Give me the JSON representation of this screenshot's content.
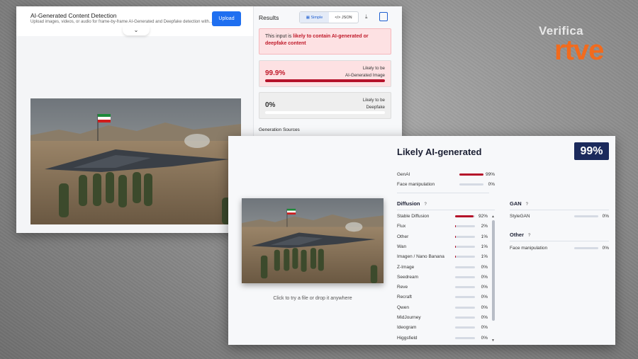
{
  "brand": {
    "top": "Verifica",
    "bottom": "rtve"
  },
  "back": {
    "title": "AI-Generated Content Detection",
    "subtitle": "Upload images, videos, or audio for frame-by-frame AI-Generated and Deepfake detection with...",
    "upload_label": "Upload",
    "results_title": "Results",
    "toggle_simple": "Simple",
    "toggle_json": "</> JSON",
    "alert_prefix": "This input is ",
    "alert_bold": "likely to contain AI-generated or deepfake content",
    "cards": [
      {
        "pct": "99.9%",
        "line1": "Likely to be",
        "line2": "AI-Generated Image",
        "value": 0.999,
        "color": "#c01a2a",
        "bg": "#fde1e3"
      },
      {
        "pct": "0%",
        "line1": "Likely to be",
        "line2": "Deepfake",
        "value": 0,
        "color": "#333333",
        "bg": "#eeeeee"
      }
    ],
    "generation_sources": "Generation Sources"
  },
  "front": {
    "hint": "Click to try a file or drop it anywhere",
    "verdict": "Likely AI-generated",
    "score": "99%",
    "top_rows": [
      {
        "name": "GenAI",
        "pct": "99%",
        "value": 0.99
      },
      {
        "name": "Face manipulation",
        "pct": "0%",
        "value": 0
      }
    ],
    "diffusion_title": "Diffusion",
    "q": "?",
    "diffusion": [
      {
        "name": "Stable Diffusion",
        "pct": "92%",
        "value": 0.92
      },
      {
        "name": "Flux",
        "pct": "2%",
        "value": 0.02
      },
      {
        "name": "Other",
        "pct": "1%",
        "value": 0.01
      },
      {
        "name": "Wan",
        "pct": "1%",
        "value": 0.01
      },
      {
        "name": "Imagen / Nano Banana",
        "pct": "1%",
        "value": 0.01
      },
      {
        "name": "Z-Image",
        "pct": "0%",
        "value": 0
      },
      {
        "name": "Seedream",
        "pct": "0%",
        "value": 0
      },
      {
        "name": "Reve",
        "pct": "0%",
        "value": 0
      },
      {
        "name": "Recraft",
        "pct": "0%",
        "value": 0
      },
      {
        "name": "Qwen",
        "pct": "0%",
        "value": 0
      },
      {
        "name": "MidJourney",
        "pct": "0%",
        "value": 0
      },
      {
        "name": "Ideogram",
        "pct": "0%",
        "value": 0
      },
      {
        "name": "Higgsfield",
        "pct": "0%",
        "value": 0
      }
    ],
    "gan_title": "GAN",
    "gan": [
      {
        "name": "StyleGAN",
        "pct": "0%",
        "value": 0
      }
    ],
    "other_title": "Other",
    "other": [
      {
        "name": "Face manipulation",
        "pct": "0%",
        "value": 0
      }
    ]
  }
}
